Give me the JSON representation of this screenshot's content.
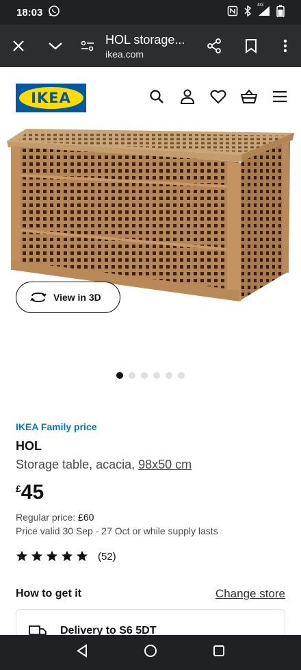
{
  "status_bar": {
    "time": "18:03",
    "network": "4G"
  },
  "browser": {
    "title": "HOL storage...",
    "url": "ikea.com"
  },
  "site": {
    "logo_text": "IKEA"
  },
  "product": {
    "view3d_label": "View in 3D",
    "image_count": 6,
    "active_image": 1,
    "family_label": "IKEA Family price",
    "name": "HOL",
    "description": "Storage table, acacia, ",
    "size": "98x50 cm",
    "currency": "£",
    "price": "45",
    "regular_label": "Regular price: ",
    "regular_price": "£60",
    "valid_text": "Price valid 30 Sep - 27 Oct or while supply lasts",
    "rating": 5,
    "rating_max": 5,
    "review_count": "(52)"
  },
  "fulfilment": {
    "title": "How to get it",
    "change_store": "Change store",
    "delivery_label": "Delivery to S6 5DT"
  },
  "colors": {
    "family_blue": "#0077c1",
    "ikea_blue": "#0058a3",
    "ikea_yellow": "#ffdb00"
  }
}
